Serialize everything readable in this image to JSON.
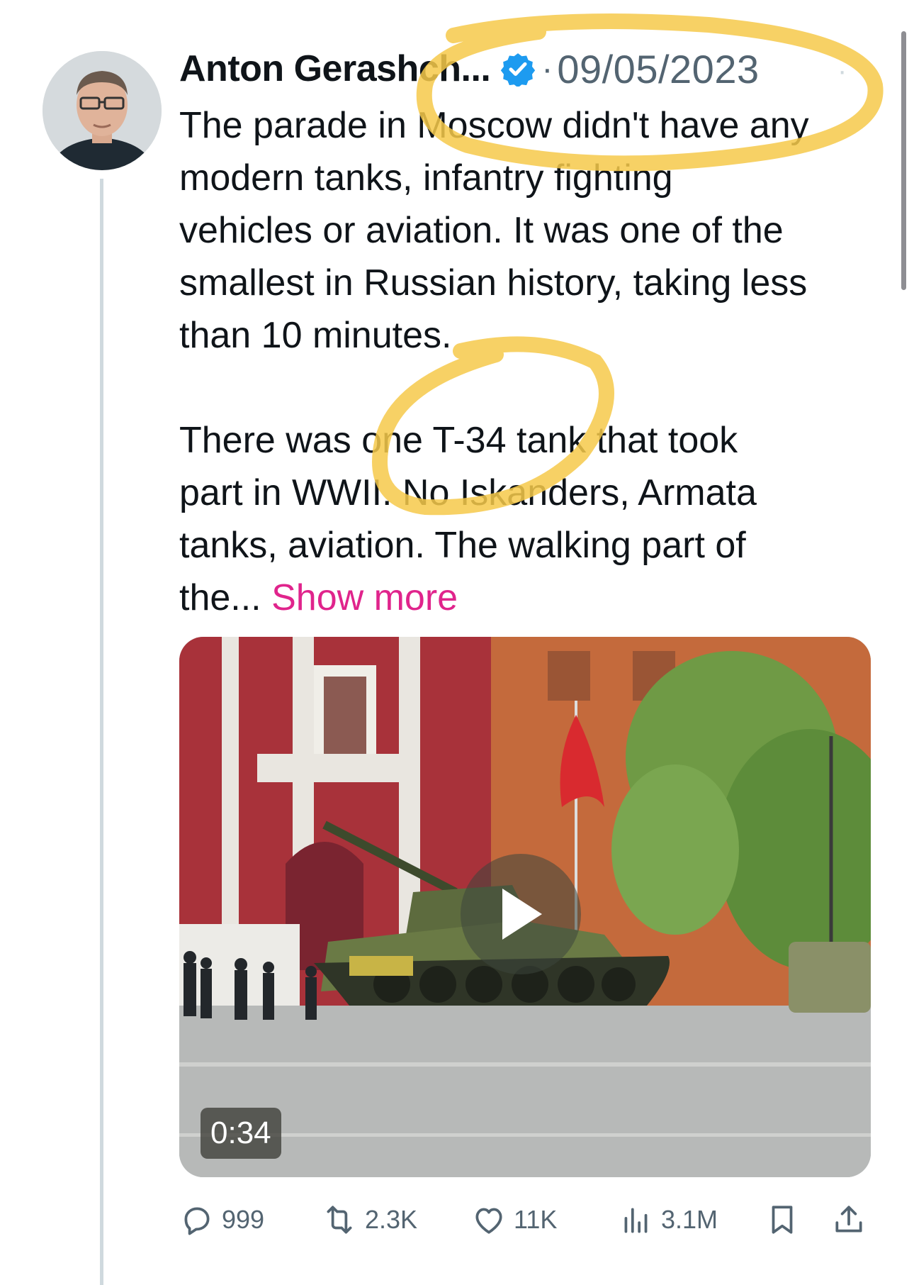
{
  "tweet": {
    "author_name": "Anton Gerashсh...",
    "date": "09/05/2023",
    "text_lines": [
      "The parade in Moscow didn't have any",
      "modern tanks, infantry fighting",
      "vehicles or aviation. It was one of the",
      "smallest in Russian history, taking less",
      "than 10 minutes.",
      "",
      "There was one T-34 tank that took",
      "part in WWII. No Iskanders, Armata",
      "tanks, aviation. The walking part of"
    ],
    "last_line_prefix": "the...",
    "show_more": "Show more",
    "video_duration": "0:34"
  },
  "actions": {
    "replies": "999",
    "retweets": "2.3K",
    "likes": "11K",
    "views": "3.1M"
  },
  "colors": {
    "verified": "#1d9bf0",
    "show_more": "#e0248c",
    "annotation": "#f6c94a"
  },
  "icons": [
    "verified-badge-icon",
    "play-icon",
    "reply-icon",
    "retweet-icon",
    "like-icon",
    "views-icon",
    "bookmark-icon",
    "share-icon"
  ]
}
